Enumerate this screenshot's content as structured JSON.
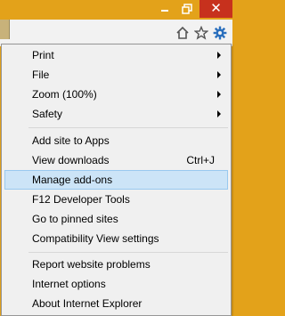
{
  "window": {
    "minimize_icon": "minimize-icon",
    "maximize_icon": "restore-icon",
    "close_label": "✕"
  },
  "toolbar": {
    "icons": [
      "home-icon",
      "favorites-star-icon",
      "tools-gear-icon"
    ],
    "accent": "#2a6fbd"
  },
  "menu": {
    "highlight_color": "#cce4f7",
    "items": [
      {
        "label": "Print",
        "submenu": true
      },
      {
        "label": "File",
        "submenu": true
      },
      {
        "label": "Zoom (100%)",
        "submenu": true
      },
      {
        "label": "Safety",
        "submenu": true
      },
      {
        "label": "Add site to Apps"
      },
      {
        "label": "View downloads",
        "shortcut": "Ctrl+J"
      },
      {
        "label": "Manage add-ons",
        "highlighted": true
      },
      {
        "label": "F12 Developer Tools"
      },
      {
        "label": "Go to pinned sites"
      },
      {
        "label": "Compatibility View settings"
      },
      {
        "label": "Report website problems"
      },
      {
        "label": "Internet options"
      },
      {
        "label": "About Internet Explorer"
      }
    ]
  }
}
